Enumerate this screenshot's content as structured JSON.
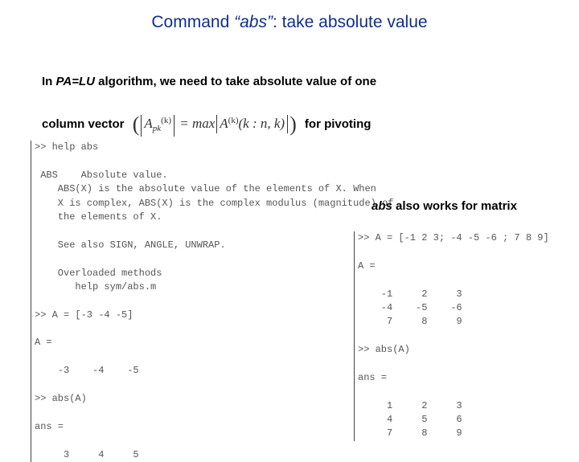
{
  "title": {
    "prefix": "Command ",
    "quoted": "“abs”",
    "suffix": ": take absolute value"
  },
  "body": {
    "line1_a": "In ",
    "palu": "PA=LU",
    "line1_b": " algorithm, we need to take absolute value of one",
    "line2_a": "column vector",
    "line2_b": "for pivoting"
  },
  "formula": {
    "lhs_base": "A",
    "lhs_sub": "pk",
    "lhs_sup": "(k)",
    "eq": " = max",
    "rhs_base": "A",
    "rhs_sup": "(k)",
    "rhs_args": "(k : n, k)"
  },
  "left_console_text": ">> help abs\n\n ABS    Absolute value.\n    ABS(X) is the absolute value of the elements of X. When\n    X is complex, ABS(X) is the complex modulus (magnitude) of\n    the elements of X.\n \n    See also SIGN, ANGLE, UNWRAP.\n\n    Overloaded methods\n       help sym/abs.m\n\n>> A = [-3 -4 -5]\n\nA =\n\n    -3    -4    -5\n\n>> abs(A)\n\nans =\n\n     3     4     5",
  "right_label": {
    "abs": "abs",
    "rest": " also works for matrix"
  },
  "right_console_text": ">> A = [-1 2 3; -4 -5 -6 ; 7 8 9]\n\nA =\n\n    -1     2     3\n    -4    -5    -6\n     7     8     9\n\n>> abs(A)\n\nans =\n\n     1     2     3\n     4     5     6\n     7     8     9"
}
